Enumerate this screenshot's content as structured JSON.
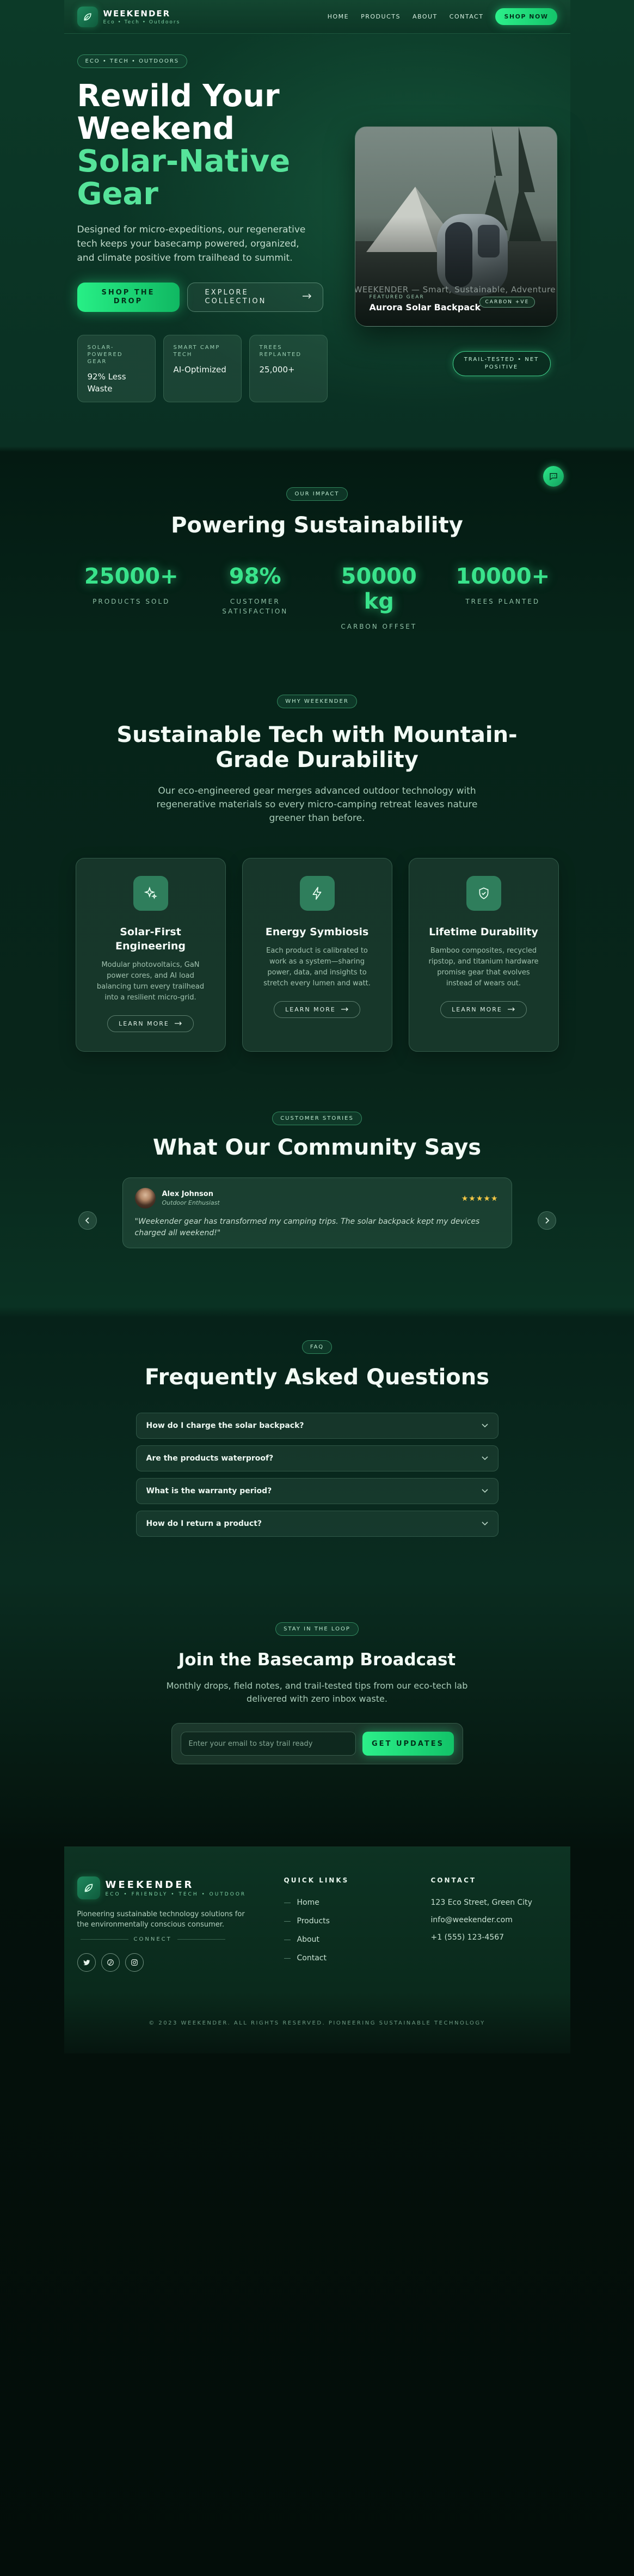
{
  "nav": {
    "brand": "WEEKENDER",
    "tagline": "Eco • Tech • Outdoors",
    "links": [
      "HOME",
      "PRODUCTS",
      "ABOUT",
      "CONTACT"
    ],
    "cta": "SHOP NOW"
  },
  "hero": {
    "badge": "ECO • TECH • OUTDOORS",
    "title_line1": "Rewild Your",
    "title_line2": "Weekend",
    "title_accent1": "Solar-Native",
    "title_accent2": "Gear",
    "description": "Designed for micro-expeditions, our regenerative tech keeps your basecamp powered, organized, and climate positive from trailhead to summit.",
    "primary_button": "SHOP THE DROP",
    "secondary_button": "EXPLORE COLLECTION",
    "stats": [
      {
        "label": "SOLAR-POWERED GEAR",
        "value": "92% Less Waste"
      },
      {
        "label": "SMART CAMP TECH",
        "value": "AI-Optimized"
      },
      {
        "label": "TREES REPLANTED",
        "value": "25,000+"
      }
    ],
    "card": {
      "marquee": "WEEKENDER — Smart, Sustainable, Adventure Ready",
      "featured_label": "FEATURED GEAR",
      "product_name": "Aurora Solar Backpack",
      "chip": "CARBON +VE"
    },
    "trail_badge": "TRAIL-TESTED • NET POSITIVE"
  },
  "impact": {
    "badge": "OUR IMPACT",
    "title": "Powering Sustainability",
    "items": [
      {
        "value": "25000+",
        "label": "PRODUCTS SOLD"
      },
      {
        "value": "98%",
        "label": "CUSTOMER SATISFACTION"
      },
      {
        "value": "50000 kg",
        "label": "CARBON OFFSET"
      },
      {
        "value": "10000+",
        "label": "TREES PLANTED"
      }
    ]
  },
  "why": {
    "badge": "WHY WEEKENDER",
    "title": "Sustainable Tech with Mountain-Grade Durability",
    "description": "Our eco-engineered gear merges advanced outdoor technology with regenerative materials so every micro-camping retreat leaves nature greener than before.",
    "features": [
      {
        "icon": "sparkles-icon",
        "title": "Solar-First Engineering",
        "description": "Modular photovoltaics, GaN power cores, and AI load balancing turn every trailhead into a resilient micro-grid.",
        "button": "LEARN MORE"
      },
      {
        "icon": "lightning-icon",
        "title": "Energy Symbiosis",
        "description": "Each product is calibrated to work as a system—sharing power, data, and insights to stretch every lumen and watt.",
        "button": "LEARN MORE"
      },
      {
        "icon": "shield-check-icon",
        "title": "Lifetime Durability",
        "description": "Bamboo composites, recycled ripstop, and titanium hardware promise gear that evolves instead of wears out.",
        "button": "LEARN MORE"
      }
    ]
  },
  "testimonials": {
    "badge": "CUSTOMER STORIES",
    "title": "What Our Community Says",
    "items": [
      {
        "name": "Alex Johnson",
        "role": "Outdoor Enthusiast",
        "stars": "★★★★★",
        "quote": "\"Weekender gear has transformed my camping trips. The solar backpack kept my devices charged all weekend!\""
      }
    ]
  },
  "faq": {
    "badge": "FAQ",
    "title": "Frequently Asked Questions",
    "items": [
      "How do I charge the solar backpack?",
      "Are the products waterproof?",
      "What is the warranty period?",
      "How do I return a product?"
    ]
  },
  "newsletter": {
    "badge": "STAY IN THE LOOP",
    "title": "Join the Basecamp Broadcast",
    "description": "Monthly drops, field notes, and trail-tested tips from our eco-tech lab delivered with zero inbox waste.",
    "placeholder": "Enter your email to stay trail ready",
    "button": "GET UPDATES"
  },
  "footer": {
    "brand": "WEEKENDER",
    "tagline": "ECO • FRIENDLY • TECH • OUTDOOR",
    "description": "Pioneering sustainable technology solutions for the environmentally conscious consumer.",
    "connect_label": "CONNECT",
    "quick_links_title": "QUICK LINKS",
    "quick_links": [
      "Home",
      "Products",
      "About",
      "Contact"
    ],
    "contact_title": "CONTACT",
    "contact": [
      "123 Eco Street, Green City",
      "info@weekender.com",
      "+1 (555) 123-4567"
    ],
    "copyright": "© 2023 WEEKENDER. ALL RIGHTS RESERVED. PIONEERING SUSTAINABLE TECHNOLOGY"
  },
  "colors": {
    "accent": "#39e38b",
    "background": "#0a3023",
    "star": "#f6c945"
  }
}
